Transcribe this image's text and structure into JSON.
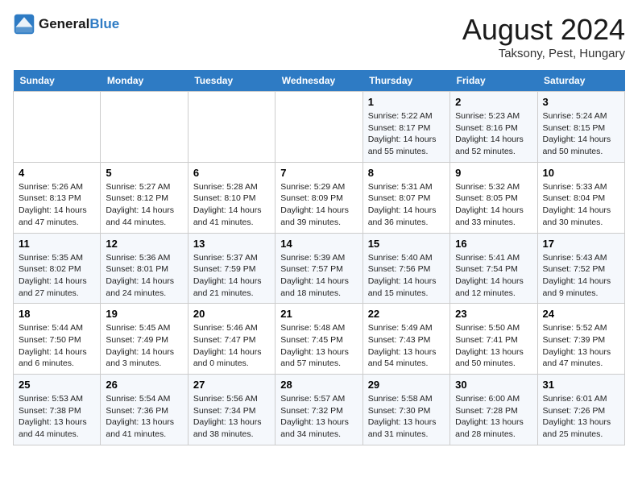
{
  "header": {
    "logo_line1": "General",
    "logo_line2": "Blue",
    "month": "August 2024",
    "location": "Taksony, Pest, Hungary"
  },
  "days_of_week": [
    "Sunday",
    "Monday",
    "Tuesday",
    "Wednesday",
    "Thursday",
    "Friday",
    "Saturday"
  ],
  "weeks": [
    [
      {
        "day": "",
        "info": ""
      },
      {
        "day": "",
        "info": ""
      },
      {
        "day": "",
        "info": ""
      },
      {
        "day": "",
        "info": ""
      },
      {
        "day": "1",
        "info": "Sunrise: 5:22 AM\nSunset: 8:17 PM\nDaylight: 14 hours\nand 55 minutes."
      },
      {
        "day": "2",
        "info": "Sunrise: 5:23 AM\nSunset: 8:16 PM\nDaylight: 14 hours\nand 52 minutes."
      },
      {
        "day": "3",
        "info": "Sunrise: 5:24 AM\nSunset: 8:15 PM\nDaylight: 14 hours\nand 50 minutes."
      }
    ],
    [
      {
        "day": "4",
        "info": "Sunrise: 5:26 AM\nSunset: 8:13 PM\nDaylight: 14 hours\nand 47 minutes."
      },
      {
        "day": "5",
        "info": "Sunrise: 5:27 AM\nSunset: 8:12 PM\nDaylight: 14 hours\nand 44 minutes."
      },
      {
        "day": "6",
        "info": "Sunrise: 5:28 AM\nSunset: 8:10 PM\nDaylight: 14 hours\nand 41 minutes."
      },
      {
        "day": "7",
        "info": "Sunrise: 5:29 AM\nSunset: 8:09 PM\nDaylight: 14 hours\nand 39 minutes."
      },
      {
        "day": "8",
        "info": "Sunrise: 5:31 AM\nSunset: 8:07 PM\nDaylight: 14 hours\nand 36 minutes."
      },
      {
        "day": "9",
        "info": "Sunrise: 5:32 AM\nSunset: 8:05 PM\nDaylight: 14 hours\nand 33 minutes."
      },
      {
        "day": "10",
        "info": "Sunrise: 5:33 AM\nSunset: 8:04 PM\nDaylight: 14 hours\nand 30 minutes."
      }
    ],
    [
      {
        "day": "11",
        "info": "Sunrise: 5:35 AM\nSunset: 8:02 PM\nDaylight: 14 hours\nand 27 minutes."
      },
      {
        "day": "12",
        "info": "Sunrise: 5:36 AM\nSunset: 8:01 PM\nDaylight: 14 hours\nand 24 minutes."
      },
      {
        "day": "13",
        "info": "Sunrise: 5:37 AM\nSunset: 7:59 PM\nDaylight: 14 hours\nand 21 minutes."
      },
      {
        "day": "14",
        "info": "Sunrise: 5:39 AM\nSunset: 7:57 PM\nDaylight: 14 hours\nand 18 minutes."
      },
      {
        "day": "15",
        "info": "Sunrise: 5:40 AM\nSunset: 7:56 PM\nDaylight: 14 hours\nand 15 minutes."
      },
      {
        "day": "16",
        "info": "Sunrise: 5:41 AM\nSunset: 7:54 PM\nDaylight: 14 hours\nand 12 minutes."
      },
      {
        "day": "17",
        "info": "Sunrise: 5:43 AM\nSunset: 7:52 PM\nDaylight: 14 hours\nand 9 minutes."
      }
    ],
    [
      {
        "day": "18",
        "info": "Sunrise: 5:44 AM\nSunset: 7:50 PM\nDaylight: 14 hours\nand 6 minutes."
      },
      {
        "day": "19",
        "info": "Sunrise: 5:45 AM\nSunset: 7:49 PM\nDaylight: 14 hours\nand 3 minutes."
      },
      {
        "day": "20",
        "info": "Sunrise: 5:46 AM\nSunset: 7:47 PM\nDaylight: 14 hours\nand 0 minutes."
      },
      {
        "day": "21",
        "info": "Sunrise: 5:48 AM\nSunset: 7:45 PM\nDaylight: 13 hours\nand 57 minutes."
      },
      {
        "day": "22",
        "info": "Sunrise: 5:49 AM\nSunset: 7:43 PM\nDaylight: 13 hours\nand 54 minutes."
      },
      {
        "day": "23",
        "info": "Sunrise: 5:50 AM\nSunset: 7:41 PM\nDaylight: 13 hours\nand 50 minutes."
      },
      {
        "day": "24",
        "info": "Sunrise: 5:52 AM\nSunset: 7:39 PM\nDaylight: 13 hours\nand 47 minutes."
      }
    ],
    [
      {
        "day": "25",
        "info": "Sunrise: 5:53 AM\nSunset: 7:38 PM\nDaylight: 13 hours\nand 44 minutes."
      },
      {
        "day": "26",
        "info": "Sunrise: 5:54 AM\nSunset: 7:36 PM\nDaylight: 13 hours\nand 41 minutes."
      },
      {
        "day": "27",
        "info": "Sunrise: 5:56 AM\nSunset: 7:34 PM\nDaylight: 13 hours\nand 38 minutes."
      },
      {
        "day": "28",
        "info": "Sunrise: 5:57 AM\nSunset: 7:32 PM\nDaylight: 13 hours\nand 34 minutes."
      },
      {
        "day": "29",
        "info": "Sunrise: 5:58 AM\nSunset: 7:30 PM\nDaylight: 13 hours\nand 31 minutes."
      },
      {
        "day": "30",
        "info": "Sunrise: 6:00 AM\nSunset: 7:28 PM\nDaylight: 13 hours\nand 28 minutes."
      },
      {
        "day": "31",
        "info": "Sunrise: 6:01 AM\nSunset: 7:26 PM\nDaylight: 13 hours\nand 25 minutes."
      }
    ]
  ]
}
